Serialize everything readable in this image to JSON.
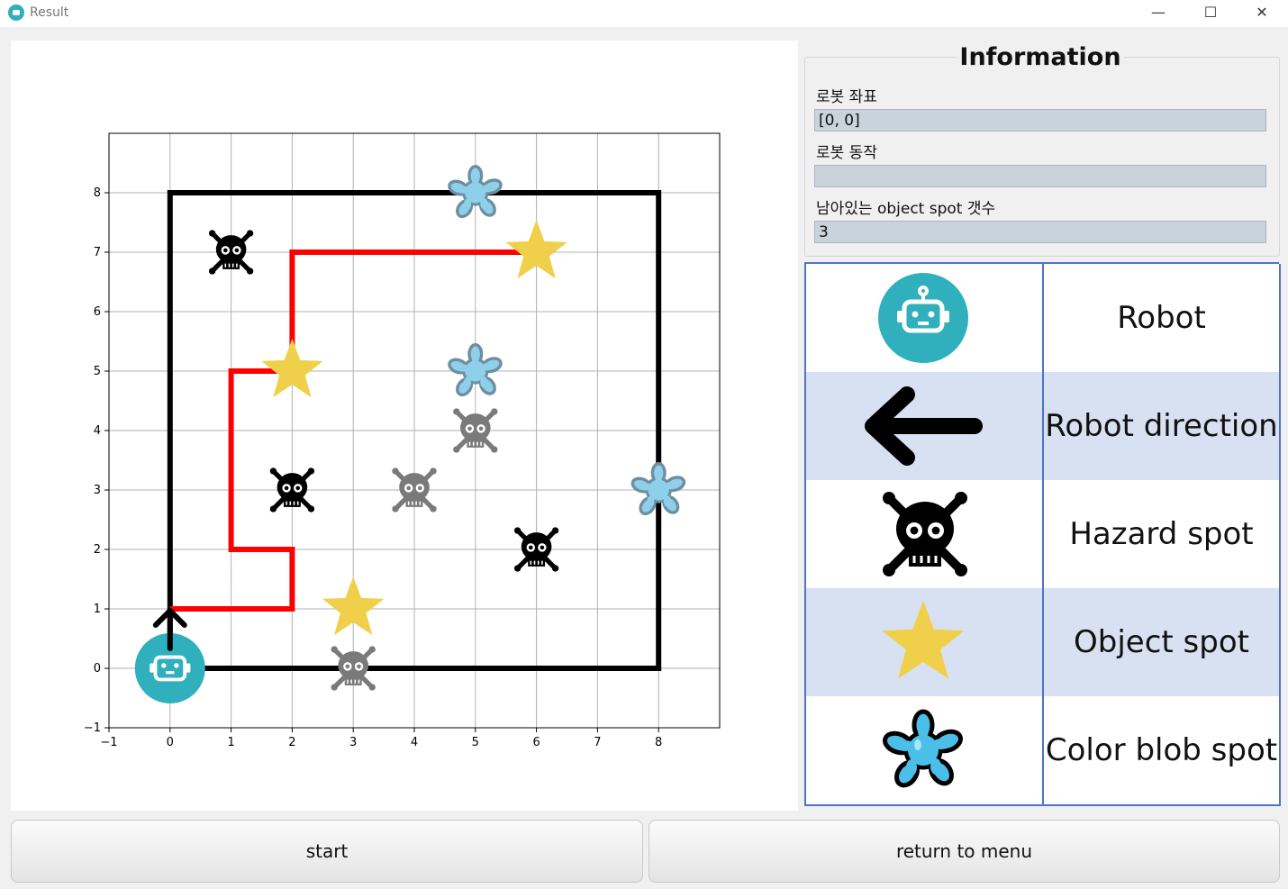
{
  "window": {
    "title": "Result",
    "minimize": "—",
    "maximize": "☐",
    "close": "✕"
  },
  "info": {
    "title": "Information",
    "position_label": "로봇 좌표",
    "position_value": "[0, 0]",
    "action_label": "로봇 동작",
    "action_value": "",
    "remaining_label": "남아있는 object spot 갯수",
    "remaining_value": "3"
  },
  "legend": [
    {
      "icon": "robot-icon",
      "label": "Robot"
    },
    {
      "icon": "arrow-left-icon",
      "label": "Robot direction"
    },
    {
      "icon": "skull-icon",
      "label": "Hazard spot"
    },
    {
      "icon": "star-icon",
      "label": "Object spot"
    },
    {
      "icon": "color-blob-icon",
      "label": "Color blob spot"
    }
  ],
  "buttons": {
    "start": "start",
    "return": "return to menu"
  },
  "colors": {
    "robot": "#2fb0bc",
    "star": "#f0d04a",
    "blob": "#8ed0ea",
    "path": "#ff0000",
    "border": "#000000",
    "legend_alt": "#d8e1f2",
    "legend_line": "#4e73c9"
  },
  "chart_data": {
    "type": "scatter",
    "xlim": [
      -1,
      9
    ],
    "ylim": [
      -1,
      9
    ],
    "xticks": [
      -1,
      0,
      1,
      2,
      3,
      4,
      5,
      6,
      7,
      8
    ],
    "yticks": [
      -1,
      0,
      1,
      2,
      3,
      4,
      5,
      6,
      7,
      8
    ],
    "grid": true,
    "boundary": [
      [
        0,
        0
      ],
      [
        8,
        0
      ],
      [
        8,
        8
      ],
      [
        0,
        8
      ],
      [
        0,
        0
      ]
    ],
    "robot": {
      "x": 0,
      "y": 0,
      "direction": "up"
    },
    "path": [
      [
        0,
        1
      ],
      [
        2,
        1
      ],
      [
        2,
        2
      ],
      [
        1,
        2
      ],
      [
        1,
        5
      ],
      [
        2,
        5
      ],
      [
        2,
        7
      ],
      [
        6,
        7
      ]
    ],
    "object_spots": [
      [
        3,
        1
      ],
      [
        2,
        5
      ],
      [
        6,
        7
      ]
    ],
    "hazard_spots_black": [
      [
        1,
        7
      ],
      [
        2,
        3
      ],
      [
        6,
        2
      ]
    ],
    "hazard_spots_gray": [
      [
        3,
        0
      ],
      [
        4,
        3
      ],
      [
        5,
        4
      ]
    ],
    "color_blobs": [
      [
        5,
        8
      ],
      [
        5,
        5
      ],
      [
        8,
        3
      ]
    ]
  }
}
